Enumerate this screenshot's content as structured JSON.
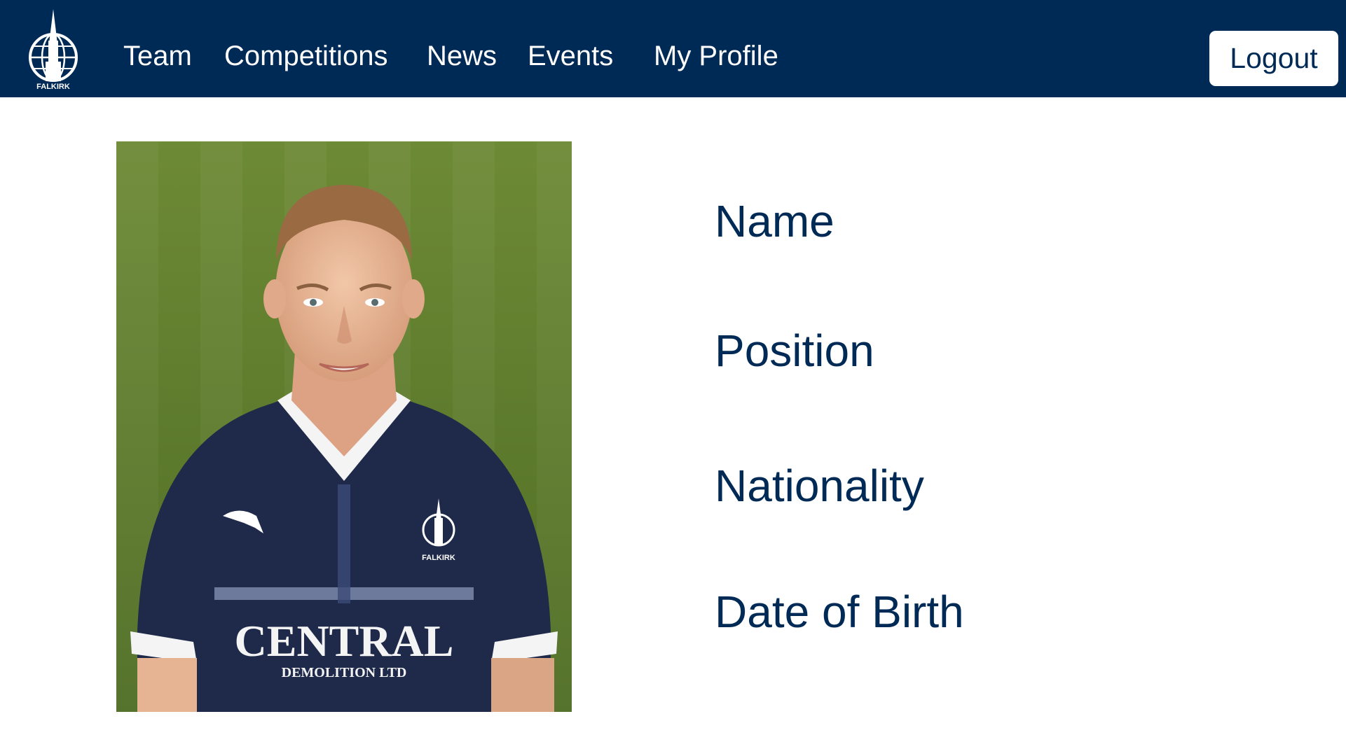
{
  "brand": {
    "logo_text": "FALKIRK",
    "color": "#002a56"
  },
  "nav": {
    "items": [
      {
        "label": "Team"
      },
      {
        "label": "Competitions"
      },
      {
        "label": "News"
      },
      {
        "label": "Events"
      },
      {
        "label": "My Profile"
      }
    ],
    "logout_label": "Logout"
  },
  "player": {
    "photo_icon": "player-portrait",
    "shirt_sponsor_line1": "CENTRAL",
    "shirt_sponsor_line2": "DEMOLITION LTD",
    "shirt_crest_text": "FALKIRK",
    "fields": {
      "name_label": "Name",
      "position_label": "Position",
      "nationality_label": "Nationality",
      "dob_label": "Date of Birth"
    }
  },
  "colors": {
    "navbar": "#002a56",
    "text_primary": "#002a56",
    "pitch_green": "#5f7d2e",
    "shirt_navy": "#1f2a4a"
  }
}
